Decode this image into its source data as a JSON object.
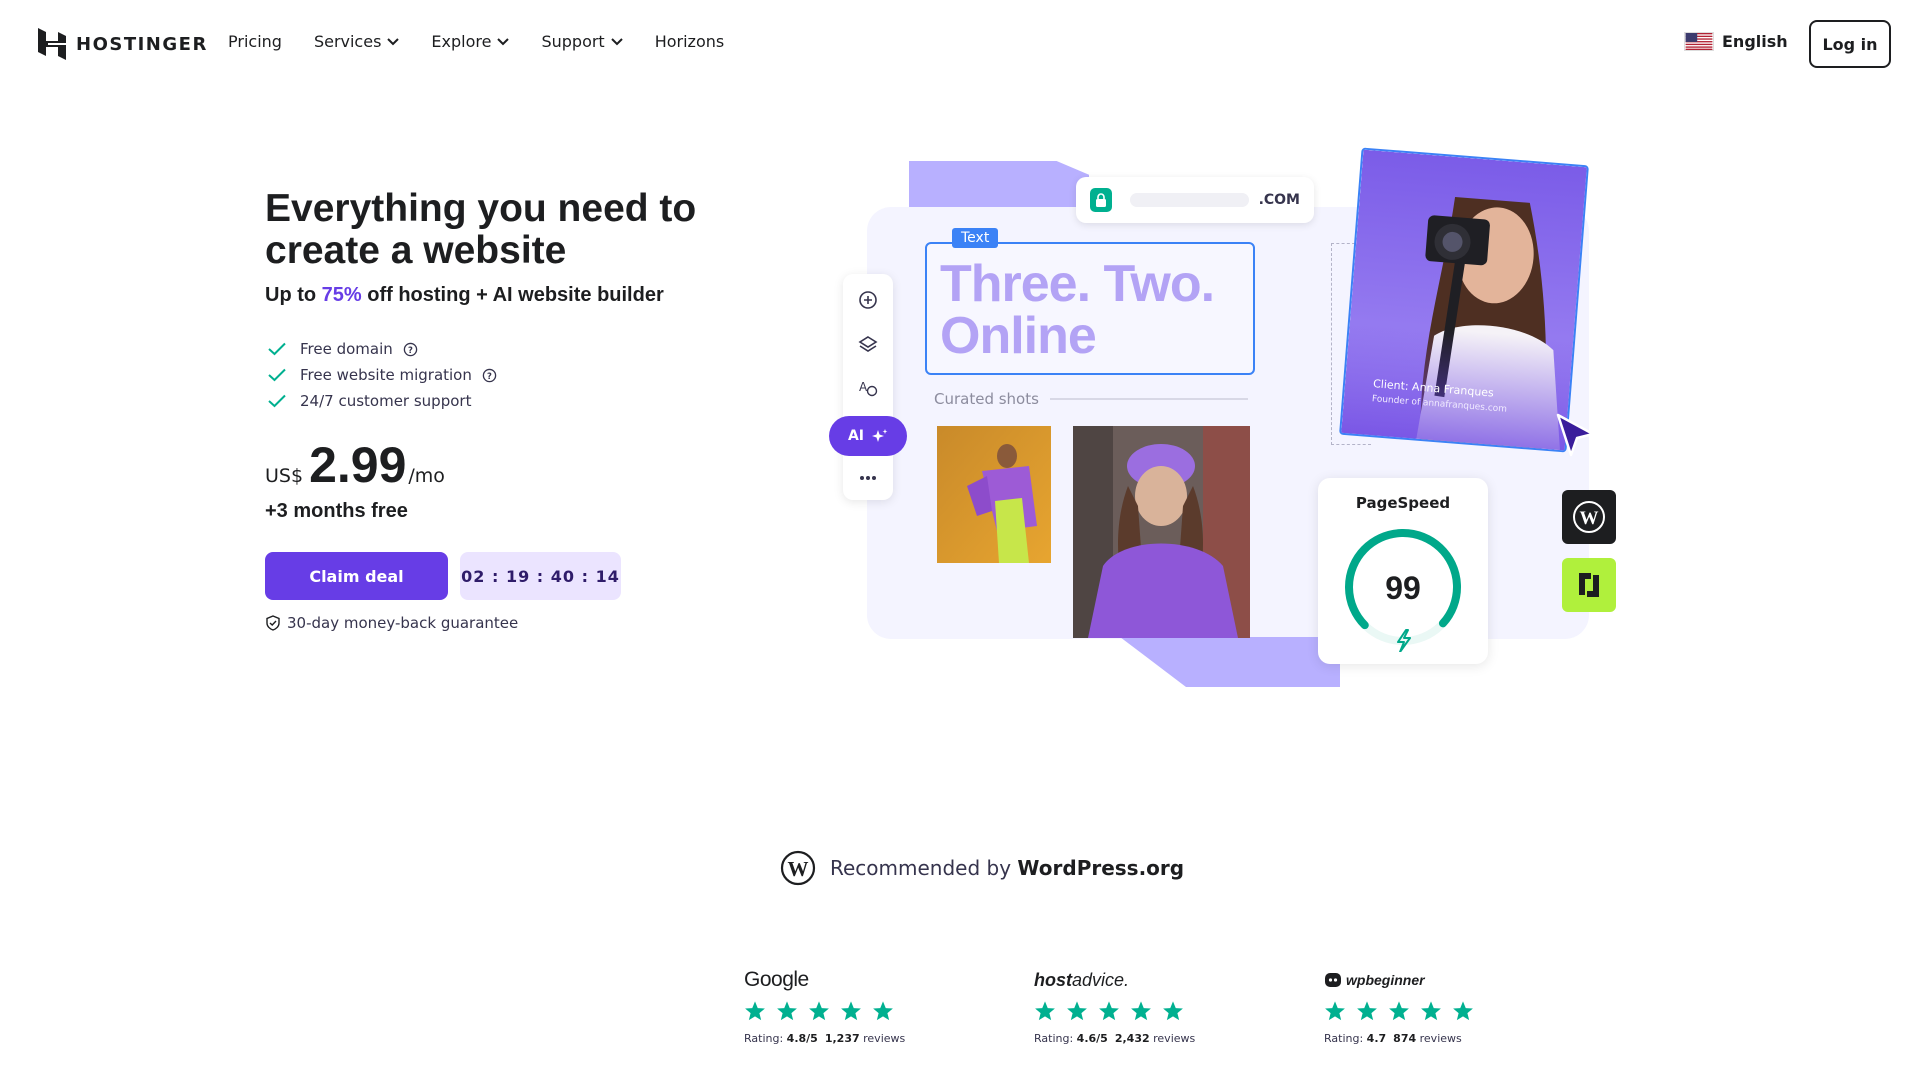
{
  "header": {
    "brand": "HOSTINGER",
    "nav": [
      {
        "label": "Pricing",
        "dropdown": false
      },
      {
        "label": "Services",
        "dropdown": true
      },
      {
        "label": "Explore",
        "dropdown": true
      },
      {
        "label": "Support",
        "dropdown": true
      },
      {
        "label": "Horizons",
        "dropdown": false
      }
    ],
    "language": "English",
    "login_label": "Log in"
  },
  "hero": {
    "title": "Everything you need to create a website",
    "subtitle_prefix": "Up to ",
    "subtitle_accent": "75%",
    "subtitle_suffix": " off hosting + AI website builder",
    "features": [
      "Free domain",
      "Free website migration",
      "24/7 customer support"
    ],
    "price_currency": "US$",
    "price_amount": "2.99",
    "price_period": "/mo",
    "bonus": "+3 months free",
    "cta_label": "Claim deal",
    "timer": "02 : 19 : 40 : 14",
    "guarantee": "30-day money-back guarantee"
  },
  "illustration": {
    "url_tld": ".COM",
    "text_tag": "Text",
    "headline": "Three. Two. Online",
    "section_label": "Curated shots",
    "ai_label": "AI",
    "client_caption_name": "Client: Anna Franques",
    "client_caption_role": "Founder of annafranques.com",
    "pagespeed_title": "PageSpeed",
    "pagespeed_score": "99",
    "pagespeed_value": 0.99
  },
  "recommended": {
    "prefix": "Recommended by ",
    "brand": "WordPress.org"
  },
  "reviews": [
    {
      "brand": "Google",
      "stars": 5,
      "rating_label": "Rating: ",
      "rating": "4.8/5",
      "count": "1,237",
      "count_label": " reviews"
    },
    {
      "brand_bold": "host",
      "brand_rest": "advice.",
      "stars": 5,
      "rating_label": "Rating: ",
      "rating": "4.6/5",
      "count": "2,432",
      "count_label": " reviews"
    },
    {
      "brand": "wpbeginner",
      "stars": 5,
      "rating_label": "Rating: ",
      "rating": "4.7",
      "count": "874",
      "count_label": " reviews"
    }
  ],
  "colors": {
    "brand": "#673de6",
    "accent_light": "#ebe4ff",
    "check": "#00b090",
    "star": "#00b090",
    "text": "#1d1e20"
  }
}
